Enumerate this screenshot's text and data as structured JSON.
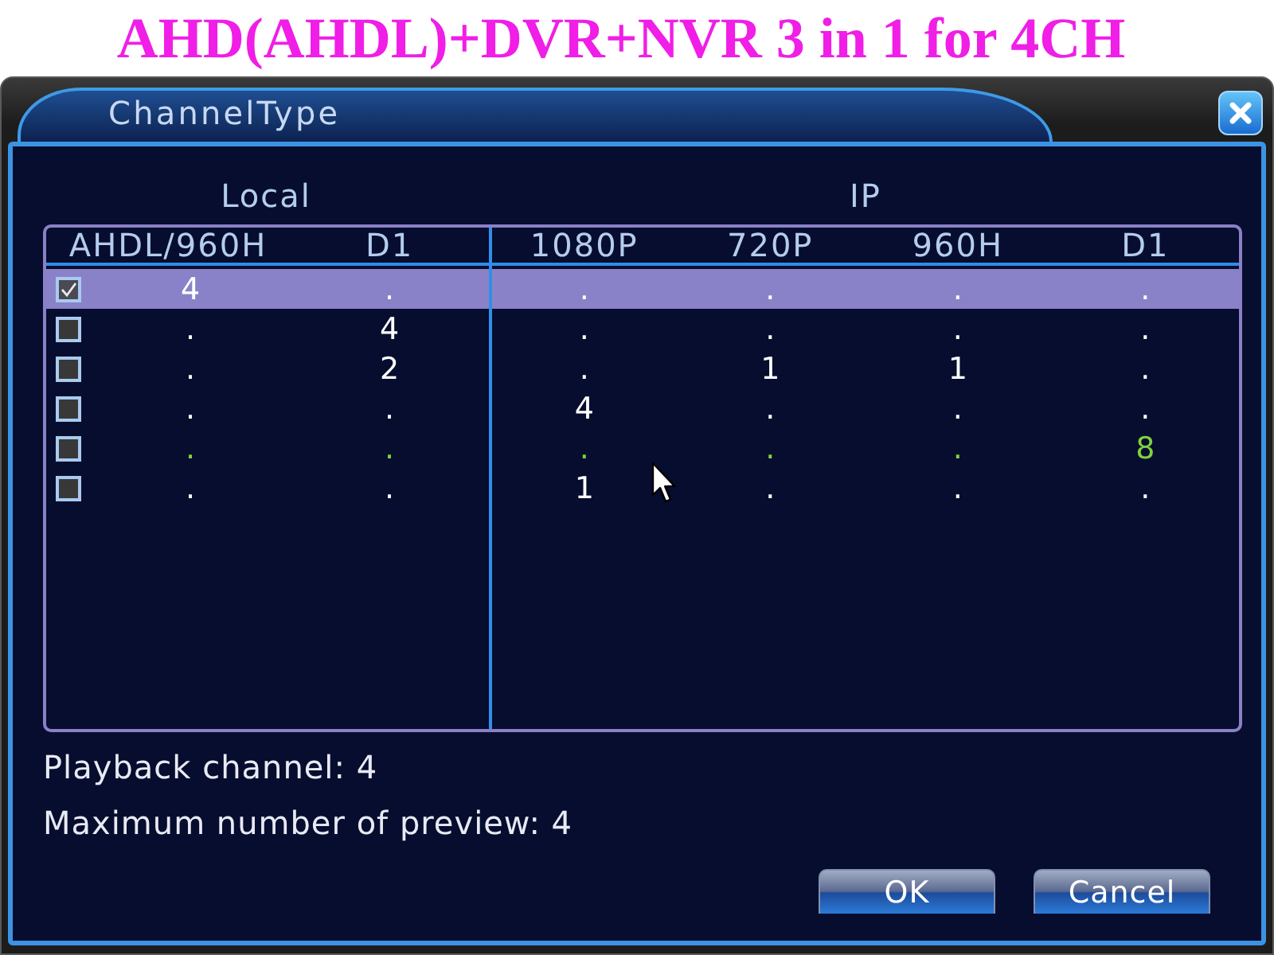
{
  "banner": {
    "title": "AHD(AHDL)+DVR+NVR 3 in 1 for 4CH"
  },
  "window": {
    "title": "ChannelType"
  },
  "table": {
    "groups": [
      {
        "label": "Local",
        "columns": [
          "AHDL/960H",
          "D1"
        ]
      },
      {
        "label": "IP",
        "columns": [
          "1080P",
          "720P",
          "960H",
          "D1"
        ]
      }
    ],
    "rows": [
      {
        "checked": true,
        "selected": true,
        "color": "#ffffff",
        "cells": [
          "4",
          ".",
          ".",
          ".",
          ".",
          "."
        ]
      },
      {
        "checked": false,
        "selected": false,
        "color": "#ffffff",
        "cells": [
          ".",
          "4",
          ".",
          ".",
          ".",
          "."
        ]
      },
      {
        "checked": false,
        "selected": false,
        "color": "#ffffff",
        "cells": [
          ".",
          "2",
          ".",
          "1",
          "1",
          "."
        ]
      },
      {
        "checked": false,
        "selected": false,
        "color": "#ffffff",
        "cells": [
          ".",
          ".",
          "4",
          ".",
          ".",
          "."
        ]
      },
      {
        "checked": false,
        "selected": false,
        "color": "#7ed43c",
        "cells": [
          ".",
          ".",
          ".",
          ".",
          ".",
          "8"
        ]
      },
      {
        "checked": false,
        "selected": false,
        "color": "#ffffff",
        "cells": [
          ".",
          ".",
          "1",
          ".",
          ".",
          "."
        ]
      }
    ]
  },
  "info": [
    "Playback channel: 4",
    "Maximum number of preview: 4"
  ],
  "buttons": [
    "OK",
    "Cancel"
  ]
}
